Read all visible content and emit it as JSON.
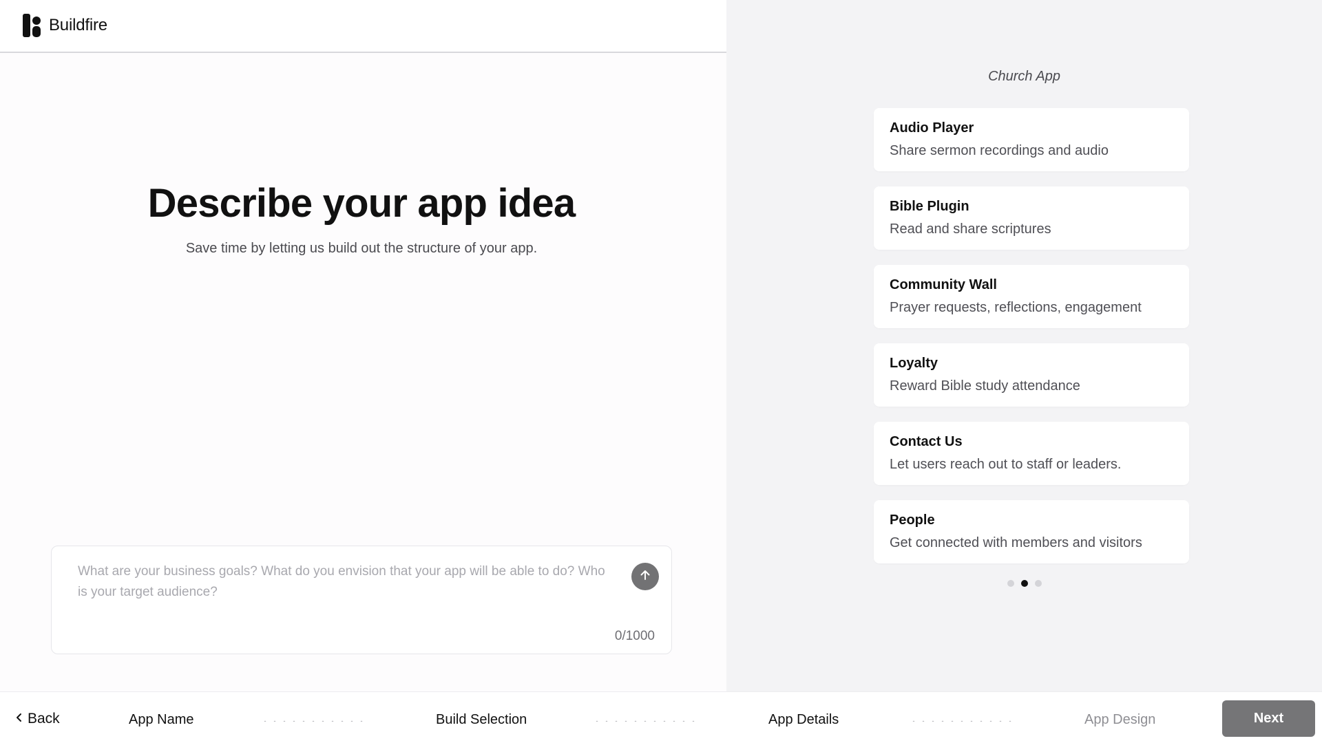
{
  "brand": {
    "name": "Buildfire",
    "logo_icon": "buildfire-logo-icon"
  },
  "hero": {
    "title": "Describe your app idea",
    "subtitle": "Save time by letting us build out the structure of your app."
  },
  "prompt": {
    "value": "",
    "placeholder": "What are your business goals? What do you envision that your app will be able to do? Who is your target audience?",
    "counter": "0/1000",
    "send_icon": "arrow-up-icon"
  },
  "preview": {
    "title": "Church App",
    "cards": [
      {
        "title": "Audio Player",
        "description": "Share sermon recordings and audio"
      },
      {
        "title": "Bible Plugin",
        "description": "Read and share scriptures"
      },
      {
        "title": "Community Wall",
        "description": "Prayer requests, reflections, engagement"
      },
      {
        "title": "Loyalty",
        "description": "Reward Bible study attendance"
      },
      {
        "title": "Contact Us",
        "description": "Let users reach out to staff or leaders."
      },
      {
        "title": "People",
        "description": "Get connected with members and visitors"
      }
    ],
    "carousel": {
      "total": 3,
      "active_index": 1
    }
  },
  "footer": {
    "back_label": "Back",
    "steps": [
      "App Name",
      "Build Selection",
      "App Details",
      "App Design"
    ],
    "next_label": "Next"
  },
  "colors": {
    "accent_gray": "#757577",
    "panel_bg": "#f3f3f5",
    "text_primary": "#111111"
  }
}
